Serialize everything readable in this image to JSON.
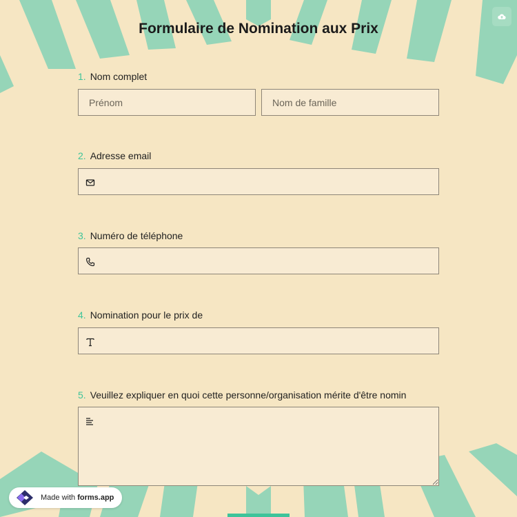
{
  "form": {
    "title": "Formulaire de Nomination aux Prix",
    "questions": [
      {
        "number": "1.",
        "label": "Nom complet",
        "first_placeholder": "Prénom",
        "last_placeholder": "Nom de famille"
      },
      {
        "number": "2.",
        "label": "Adresse email",
        "icon": "envelope-icon"
      },
      {
        "number": "3.",
        "label": "Numéro de téléphone",
        "icon": "phone-icon"
      },
      {
        "number": "4.",
        "label": "Nomination pour le prix de",
        "icon": "text-icon"
      },
      {
        "number": "5.",
        "label": "Veuillez expliquer en quoi cette personne/organisation mérite d'être nomin",
        "icon": "paragraph-icon"
      }
    ]
  },
  "badge": {
    "prefix": "Made with",
    "brand": "forms.app"
  },
  "colors": {
    "background": "#f6e6c3",
    "ray": "#96d5b8",
    "accent": "#3ec49a",
    "field_bg": "#f8ebd3",
    "field_border": "#8d8577"
  },
  "icons": {
    "save": "cloud-upload-icon"
  }
}
